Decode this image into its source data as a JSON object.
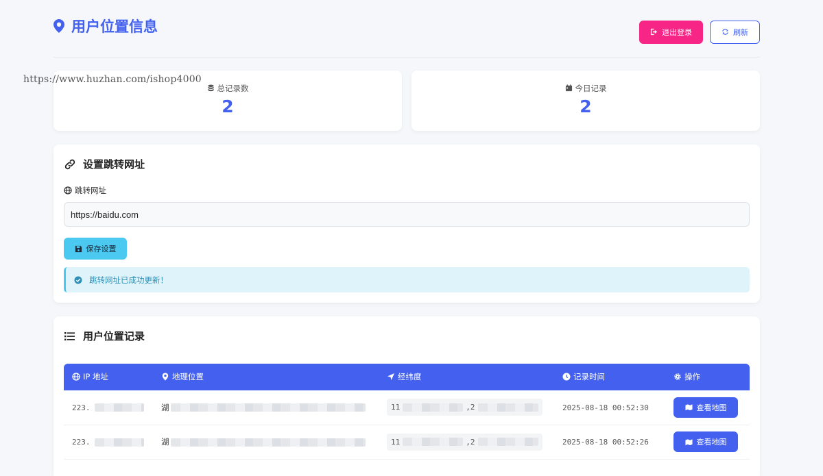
{
  "header": {
    "title": "用户位置信息",
    "logout_label": "退出登录",
    "refresh_label": "刷新"
  },
  "watermark": "https://www.huzhan.com/ishop4000",
  "stats": [
    {
      "label": "总记录数",
      "value": "2",
      "icon": "database-icon"
    },
    {
      "label": "今日记录",
      "value": "2",
      "icon": "calendar-icon"
    }
  ],
  "redirect": {
    "title": "设置跳转网址",
    "field_label": "跳转网址",
    "url_value": "https://baidu.com",
    "save_label": "保存设置",
    "alert": "跳转网址已成功更新！"
  },
  "records": {
    "title": "用户位置记录",
    "columns": [
      "IP 地址",
      "地理位置",
      "经纬度",
      "记录时间",
      "操作"
    ],
    "rows": [
      {
        "ip": "223.",
        "location": "湖",
        "lng": "11",
        "lat": "2",
        "time": "2025-08-18 00:52:30",
        "action": "查看地图"
      },
      {
        "ip": "223.",
        "location": "湖",
        "lng": "11",
        "lat": "2",
        "time": "2025-08-18 00:52:26",
        "action": "查看地图"
      }
    ]
  },
  "colors": {
    "primary": "#4361ee",
    "danger": "#f72585",
    "info": "#4cc9f0"
  }
}
